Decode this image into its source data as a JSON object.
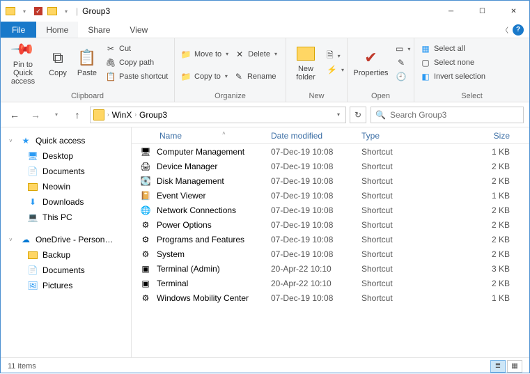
{
  "window": {
    "title": "Group3"
  },
  "menubar": {
    "file": "File",
    "tabs": [
      "Home",
      "Share",
      "View"
    ],
    "active": 0
  },
  "ribbon": {
    "clipboard": {
      "label": "Clipboard",
      "pin": "Pin to Quick access",
      "copy": "Copy",
      "paste": "Paste",
      "cut": "Cut",
      "copy_path": "Copy path",
      "paste_shortcut": "Paste shortcut"
    },
    "organize": {
      "label": "Organize",
      "move_to": "Move to",
      "copy_to": "Copy to",
      "delete": "Delete",
      "rename": "Rename"
    },
    "new": {
      "label": "New",
      "new_folder": "New folder"
    },
    "open": {
      "label": "Open",
      "properties": "Properties"
    },
    "select": {
      "label": "Select",
      "select_all": "Select all",
      "select_none": "Select none",
      "invert": "Invert selection"
    }
  },
  "breadcrumb": {
    "parts": [
      "WinX",
      "Group3"
    ]
  },
  "search": {
    "placeholder": "Search Group3"
  },
  "sidebar": {
    "quick_access": "Quick access",
    "qa_items": [
      "Desktop",
      "Documents",
      "Neowin",
      "Downloads",
      "This PC"
    ],
    "onedrive": "OneDrive - Person…",
    "od_items": [
      "Backup",
      "Documents",
      "Pictures"
    ]
  },
  "columns": {
    "name": "Name",
    "date": "Date modified",
    "type": "Type",
    "size": "Size"
  },
  "files": [
    {
      "icon": "mgmt",
      "name": "Computer Management",
      "date": "07-Dec-19 10:08",
      "type": "Shortcut",
      "size": "1 KB"
    },
    {
      "icon": "device",
      "name": "Device Manager",
      "date": "07-Dec-19 10:08",
      "type": "Shortcut",
      "size": "2 KB"
    },
    {
      "icon": "disk",
      "name": "Disk Management",
      "date": "07-Dec-19 10:08",
      "type": "Shortcut",
      "size": "2 KB"
    },
    {
      "icon": "event",
      "name": "Event Viewer",
      "date": "07-Dec-19 10:08",
      "type": "Shortcut",
      "size": "1 KB"
    },
    {
      "icon": "net",
      "name": "Network Connections",
      "date": "07-Dec-19 10:08",
      "type": "Shortcut",
      "size": "2 KB"
    },
    {
      "icon": "power",
      "name": "Power Options",
      "date": "07-Dec-19 10:08",
      "type": "Shortcut",
      "size": "2 KB"
    },
    {
      "icon": "prog",
      "name": "Programs and Features",
      "date": "07-Dec-19 10:08",
      "type": "Shortcut",
      "size": "2 KB"
    },
    {
      "icon": "system",
      "name": "System",
      "date": "07-Dec-19 10:08",
      "type": "Shortcut",
      "size": "2 KB"
    },
    {
      "icon": "terminal",
      "name": "Terminal (Admin)",
      "date": "20-Apr-22 10:10",
      "type": "Shortcut",
      "size": "3 KB"
    },
    {
      "icon": "terminal",
      "name": "Terminal",
      "date": "20-Apr-22 10:10",
      "type": "Shortcut",
      "size": "2 KB"
    },
    {
      "icon": "mobility",
      "name": "Windows Mobility Center",
      "date": "07-Dec-19 10:08",
      "type": "Shortcut",
      "size": "1 KB"
    }
  ],
  "status": {
    "count": "11 items"
  }
}
